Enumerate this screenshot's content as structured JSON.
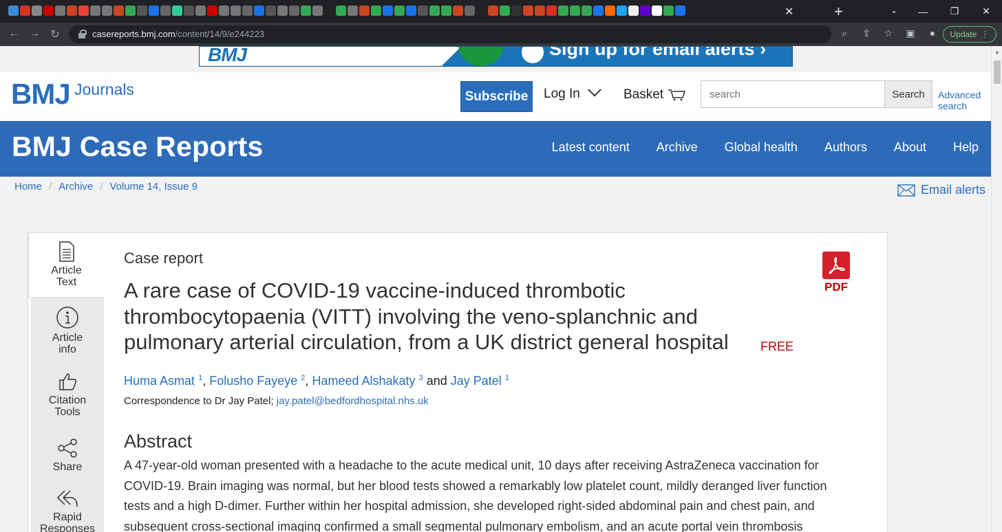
{
  "browser": {
    "url_host": "casereports.bmj.com",
    "url_path": "/content/14/9/e244223",
    "update_label": "Update",
    "tab_colors": [
      "#3b8bd4",
      "#d93025",
      "#888",
      "#c00",
      "#777",
      "#c42",
      "#ea4335",
      "#777",
      "#777",
      "#c42",
      "#34a853",
      "#555",
      "#1a73e8",
      "#666",
      "#3c9",
      "#555",
      "#777",
      "#c00",
      "#777",
      "#777",
      "#666",
      "#1a73e8",
      "#555",
      "#777",
      "#666",
      "#34a853",
      "#777",
      "#222",
      "#34a853",
      "#777",
      "#c42",
      "#34a853",
      "#1a73e8",
      "#34a853",
      "#1a73e8",
      "#555",
      "#34a853",
      "#34a853",
      "#c42",
      "#666",
      "#222",
      "#c42",
      "#34a853",
      "#333",
      "#c42",
      "#c42",
      "#d93025",
      "#34a853",
      "#34a853",
      "#34a853",
      "#1a73e8",
      "#f60",
      "#1da1f2",
      "#eee",
      "#6001d2",
      "#fff",
      "#34a853",
      "#1a73e8"
    ]
  },
  "ad": {
    "logo": "BMJ",
    "text": "Sign up for email alerts ›"
  },
  "header": {
    "logo_main": "BMJ",
    "logo_sub": "Journals",
    "subscribe": "Subscribe",
    "login": "Log In",
    "basket": "Basket",
    "search_placeholder": "search",
    "search_button": "Search",
    "advanced_search": "Advanced search"
  },
  "banner": {
    "journal_title": "BMJ Case Reports",
    "nav": [
      "Latest content",
      "Archive",
      "Global health",
      "Authors",
      "About",
      "Help"
    ]
  },
  "breadcrumb": [
    "Home",
    "Archive",
    "Volume 14, Issue 9"
  ],
  "email_alerts": "Email alerts",
  "sidebar": {
    "tabs": [
      {
        "line1": "Article",
        "line2": "Text"
      },
      {
        "line1": "Article",
        "line2": "info"
      },
      {
        "line1": "Citation",
        "line2": "Tools"
      },
      {
        "line1": "Share",
        "line2": ""
      },
      {
        "line1": "Rapid",
        "line2": "Responses"
      }
    ]
  },
  "article": {
    "type": "Case report",
    "title": "A rare case of COVID-19 vaccine-induced thrombotic thrombocytopaenia (VITT) involving the veno-splanchnic and pulmonary arterial circulation, from a UK district general hospital",
    "free_label": "FREE",
    "pdf_label": "PDF",
    "authors": [
      {
        "name": "Huma Asmat",
        "aff": "1"
      },
      {
        "name": "Folusho Fayeye",
        "aff": "2"
      },
      {
        "name": "Hameed Alshakaty",
        "aff": "3"
      },
      {
        "name": "Jay Patel",
        "aff": "1"
      }
    ],
    "authors_and": "and",
    "correspondence_prefix": "Correspondence to Dr Jay Patel;",
    "correspondence_email": "jay.patel@bedfordhospital.nhs.uk",
    "abstract_heading": "Abstract",
    "abstract_text": "A 47-year-old woman presented with a headache to the acute medical unit, 10 days after receiving AstraZeneca vaccination for COVID-19. Brain imaging was normal, but her blood tests showed a remarkably low platelet count, mildly deranged liver function tests and a high D-dimer. Further within her hospital admission, she developed right-sided abdominal pain and chest pain, and subsequent cross-sectional imaging confirmed a small segmental pulmonary embolism, and an acute portal vein thrombosis"
  }
}
